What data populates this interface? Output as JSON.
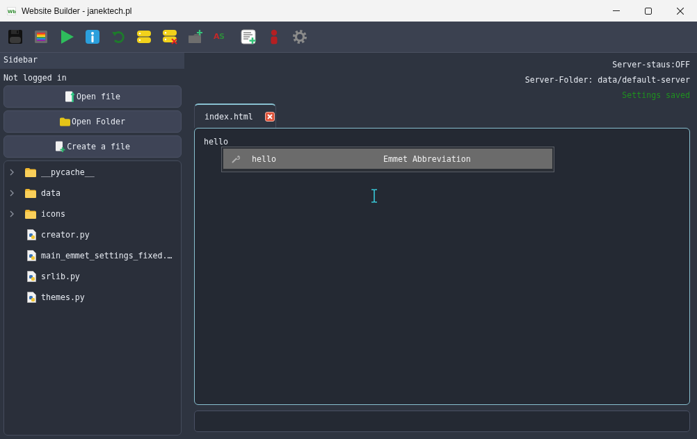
{
  "window": {
    "app_icon_text": "Wb",
    "title": "Website Builder - janektech.pl"
  },
  "toolbar": [
    {
      "kind": "save"
    },
    {
      "kind": "palette"
    },
    {
      "kind": "run"
    },
    {
      "kind": "info"
    },
    {
      "kind": "refresh"
    },
    {
      "kind": "server"
    },
    {
      "kind": "server-remove"
    },
    {
      "kind": "folder-add"
    },
    {
      "kind": "text",
      "label": "AS"
    },
    {
      "kind": "document-add"
    },
    {
      "kind": "user"
    },
    {
      "kind": "settings"
    }
  ],
  "sidebar": {
    "title": "Sidebar",
    "login_status": "Not logged in",
    "buttons": [
      {
        "kind": "file-open",
        "label": "Open file"
      },
      {
        "kind": "folder-open",
        "label": "Open Folder"
      },
      {
        "kind": "file-new",
        "label": "Create a file"
      }
    ],
    "file_tree": [
      {
        "kind": "folder",
        "label": "__pycache__",
        "expanded": false
      },
      {
        "kind": "folder",
        "label": "data",
        "expanded": false
      },
      {
        "kind": "folder",
        "label": "icons",
        "expanded": false
      },
      {
        "kind": "python",
        "label": "creator.py"
      },
      {
        "kind": "python",
        "label": "main_emmet_settings_fixed.…"
      },
      {
        "kind": "python",
        "label": "srlib.py"
      },
      {
        "kind": "python",
        "label": "themes.py"
      }
    ]
  },
  "status_lines": [
    {
      "kind": "info",
      "text": "Server-staus:OFF"
    },
    {
      "kind": "info",
      "text": "Server-Folder: data/default-server"
    },
    {
      "kind": "success",
      "text": "Settings saved"
    }
  ],
  "tabs": [
    {
      "label": "index.html",
      "selected": true
    }
  ],
  "editor": {
    "lines": [
      "hello"
    ],
    "completions": [
      {
        "label": "hello",
        "detail": "Emmet Abbreviation",
        "selected": true
      }
    ]
  }
}
